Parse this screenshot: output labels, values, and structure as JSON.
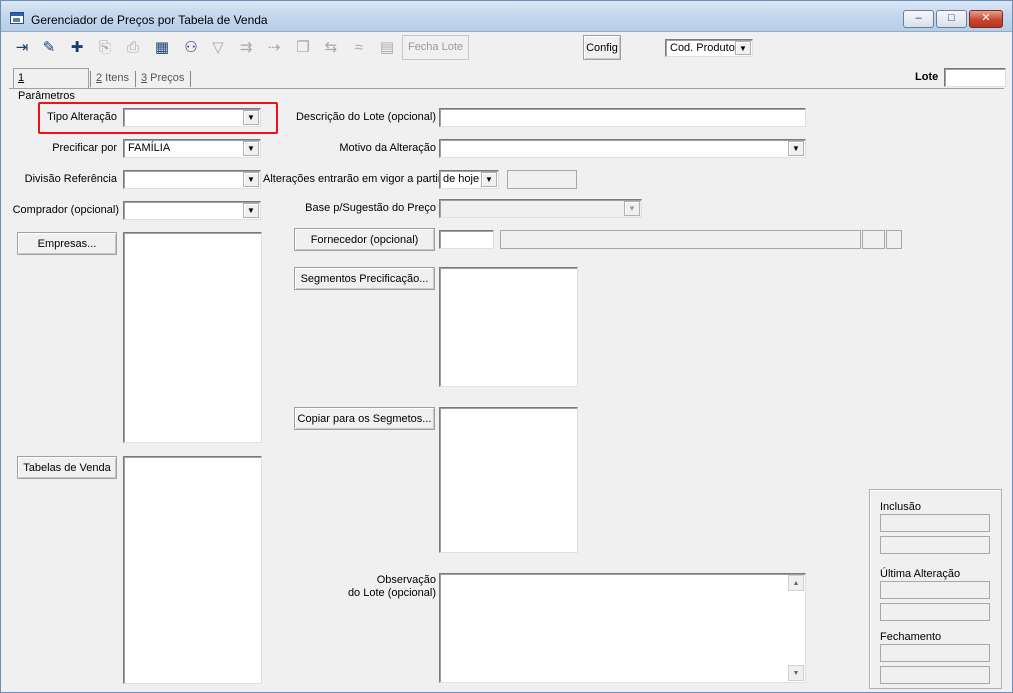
{
  "window": {
    "title": "Gerenciador de Preços por Tabela de Venda",
    "minimize_label": "–",
    "maximize_label": "□",
    "close_label": "✕"
  },
  "toolbar": {
    "fecha_lote_label": "Fecha Lote",
    "config_label": "Config",
    "sort_select_value": "Cod. Produto",
    "icons": [
      "exit-icon",
      "eraser-icon",
      "add-record-icon",
      "copy-icon",
      "print-icon",
      "spreadsheet-icon",
      "binoculars-icon",
      "filter-icon",
      "export-icon",
      "import-icon",
      "duplicate-icon",
      "price-icon",
      "chart-icon",
      "grid-icon"
    ]
  },
  "tabs": [
    {
      "key": "1",
      "label": " Parâmetros"
    },
    {
      "key": "2",
      "label": " Itens"
    },
    {
      "key": "3",
      "label": " Preços"
    }
  ],
  "lote": {
    "label": "Lote",
    "value": ""
  },
  "left": {
    "tipo_alteracao_label": "Tipo Alteração",
    "tipo_alteracao_value": "",
    "precificar_por_label": "Precificar por",
    "precificar_por_value": "FAMÍLIA",
    "divisao_referencia_label": "Divisão Referência",
    "divisao_referencia_value": "",
    "comprador_label": "Comprador (opcional)",
    "comprador_value": "",
    "empresas_button": "Empresas...",
    "tabelas_venda_button": "Tabelas de Venda"
  },
  "middle": {
    "descricao_lote_label": "Descrição do Lote (opcional)",
    "descricao_lote_value": "",
    "motivo_alteracao_label": "Motivo da Alteração",
    "motivo_alteracao_value": "",
    "vigor_label": "Alterações entrarão em vigor a partir",
    "vigor_value": "de hoje",
    "base_sugestao_label": "Base p/Sugestão do Preço",
    "fornecedor_button": "Fornecedor (opcional)",
    "segmentos_button": "Segmentos Precificação...",
    "copiar_segmentos_button": "Copiar para os Segmetos...",
    "observacao_label_1": "Observação",
    "observacao_label_2": "do Lote (opcional)"
  },
  "audit": {
    "inclusao_label": "Inclusão",
    "ultima_alteracao_label": "Última Alteração",
    "fechamento_label": "Fechamento"
  },
  "colors": {
    "highlight": "#e8121b",
    "window_bg": "#f0f0f0"
  }
}
